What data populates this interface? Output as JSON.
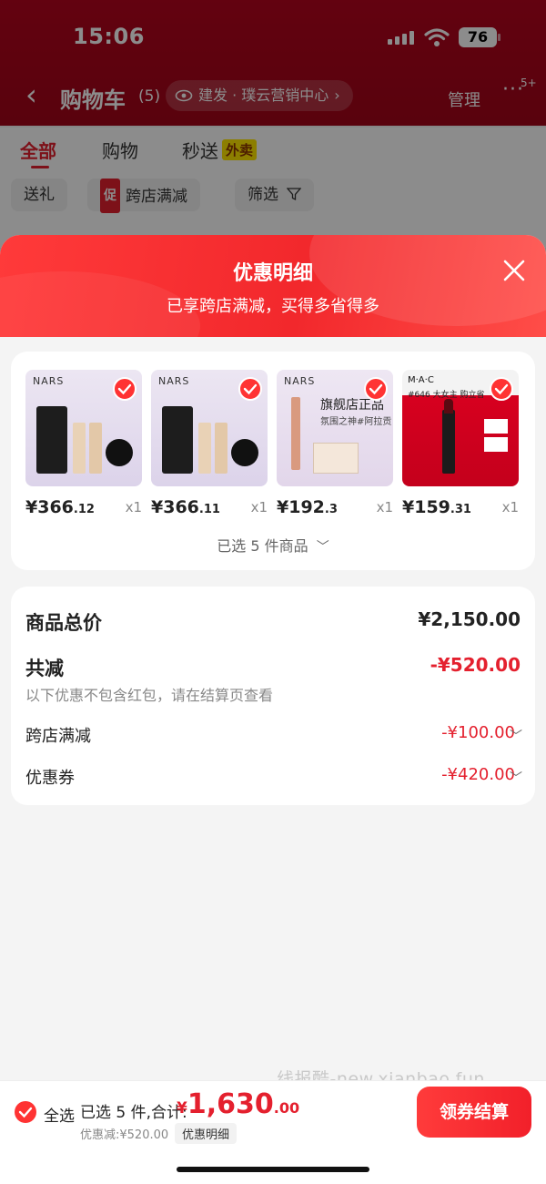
{
  "status_bar": {
    "time": "15:06",
    "battery": "76"
  },
  "nav": {
    "title": "购物车",
    "count": "(5)",
    "store_pill": "建发 · 璞云营销中心",
    "manage": "管理",
    "more_badge": "5+"
  },
  "tabs": [
    {
      "label": "全部"
    },
    {
      "label": "购物"
    },
    {
      "label": "秒送",
      "badge": "外卖"
    }
  ],
  "filters": [
    {
      "label": "送礼"
    },
    {
      "label": "跨店满减",
      "badge": "促"
    },
    {
      "label": "筛选"
    }
  ],
  "sheet": {
    "title": "优惠明细",
    "subtitle": "已享跨店满减，买得多省得多"
  },
  "products": [
    {
      "price_int": "¥366",
      "price_dec": ".12",
      "qty": "x1",
      "brand": "NARS"
    },
    {
      "price_int": "¥366",
      "price_dec": ".11",
      "qty": "x1",
      "brand": "NARS"
    },
    {
      "price_int": "¥192",
      "price_dec": ".3",
      "qty": "x1",
      "brand": "NARS",
      "tagline": "旗舰店正品",
      "tagline2": "氛围之神#阿拉贡"
    },
    {
      "price_int": "¥159",
      "price_dec": ".31",
      "qty": "x1",
      "brand": "M·A·C",
      "tagline": "#646 大女主 购立省"
    }
  ],
  "selected_count": "已选 5 件商品",
  "summary": {
    "total_label": "商品总价",
    "total_value": "¥2,150.00",
    "reduce_label": "共减",
    "reduce_value": "-¥520.00",
    "note": "以下优惠不包含红包，请在结算页查看",
    "items": [
      {
        "label": "跨店满减",
        "value": "-¥100.00"
      },
      {
        "label": "优惠券",
        "value": "-¥420.00"
      }
    ]
  },
  "watermark": "线报酷-new.xianbao.fun",
  "bottom": {
    "select_all": "全选",
    "selected_info": "已选 5 件,合计:",
    "total_yen": "¥",
    "total_int": "1,630",
    "total_dec": ".00",
    "discount": "优惠减:¥520.00",
    "detail": "优惠明细",
    "checkout": "领券结算"
  },
  "colors": {
    "accent": "#e4202e",
    "header_bg": "#b4041e"
  }
}
